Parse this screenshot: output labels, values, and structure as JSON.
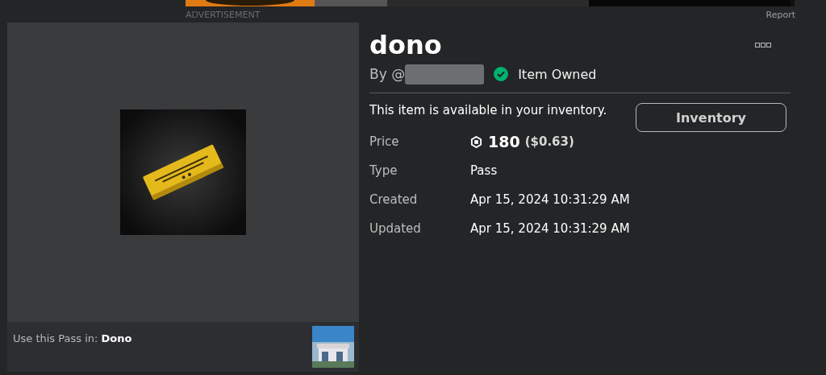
{
  "advertisement": {
    "label": "ADVERTISEMENT",
    "report": "Report"
  },
  "item": {
    "title": "dono",
    "creator_prefix": "By @",
    "owned": true,
    "owned_label": "Item Owned",
    "availability": "This item is available in your inventory.",
    "action_button": "Inventory",
    "details": [
      {
        "label": "Price",
        "value": "180",
        "extra": "($0.63)",
        "kind": "price"
      },
      {
        "label": "Type",
        "value": "Pass",
        "kind": "text"
      },
      {
        "label": "Created",
        "value": "Apr 15, 2024 10:31:29 AM",
        "kind": "text"
      },
      {
        "label": "Updated",
        "value": "Apr 15, 2024 10:31:29 AM",
        "kind": "text"
      }
    ]
  },
  "place": {
    "text": "Use this Pass in: **Dono**"
  }
}
